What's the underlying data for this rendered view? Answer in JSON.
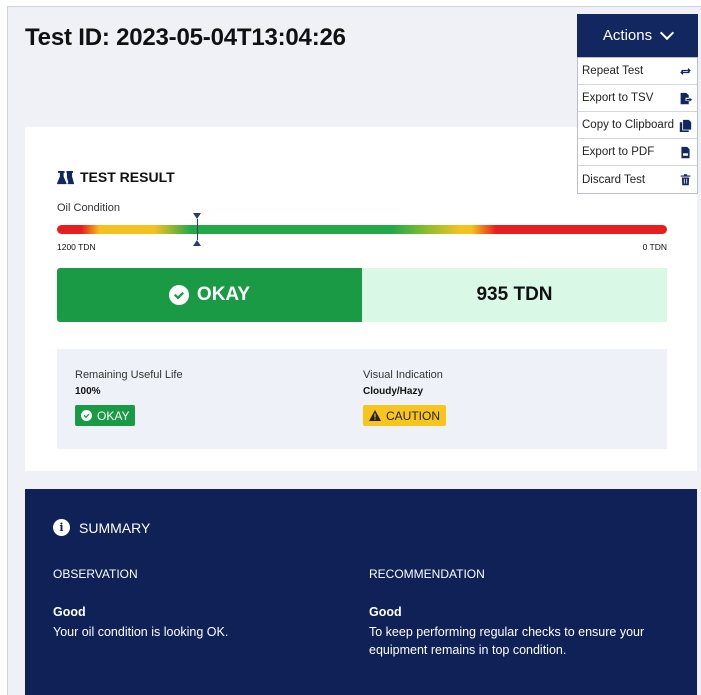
{
  "header": {
    "title": "Test ID: 2023-05-04T13:04:26"
  },
  "actions": {
    "label": "Actions",
    "items": [
      {
        "label": "Repeat Test",
        "icon": "repeat-icon"
      },
      {
        "label": "Export to TSV",
        "icon": "export-file-icon"
      },
      {
        "label": "Copy to Clipboard",
        "icon": "copy-icon"
      },
      {
        "label": "Export to PDF",
        "icon": "pdf-icon"
      },
      {
        "label": "Discard Test",
        "icon": "trash-icon"
      }
    ]
  },
  "result": {
    "heading": "TEST RESULT",
    "gauge_label": "Oil Condition",
    "scale_left": "1200 TDN",
    "scale_right": "0 TDN",
    "marker_fraction": 0.23,
    "status_label": "OKAY",
    "status_value": "935 TDN",
    "details": {
      "rul_label": "Remaining Useful Life",
      "rul_value": "100%",
      "rul_badge": "OKAY",
      "visual_label": "Visual Indication",
      "visual_value": "Cloudy/Hazy",
      "visual_badge": "CAUTION"
    },
    "colors": {
      "ok": "#1a9a45",
      "caution": "#f7c51c",
      "danger": "#e81d1d",
      "navy": "#122660"
    }
  },
  "summary": {
    "heading": "SUMMARY",
    "observation": {
      "heading": "OBSERVATION",
      "value": "Good",
      "text": "Your oil condition is looking OK."
    },
    "recommendation": {
      "heading": "RECOMMENDATION",
      "value": "Good",
      "text": "To keep performing regular checks to ensure your equipment remains in top condition."
    }
  }
}
